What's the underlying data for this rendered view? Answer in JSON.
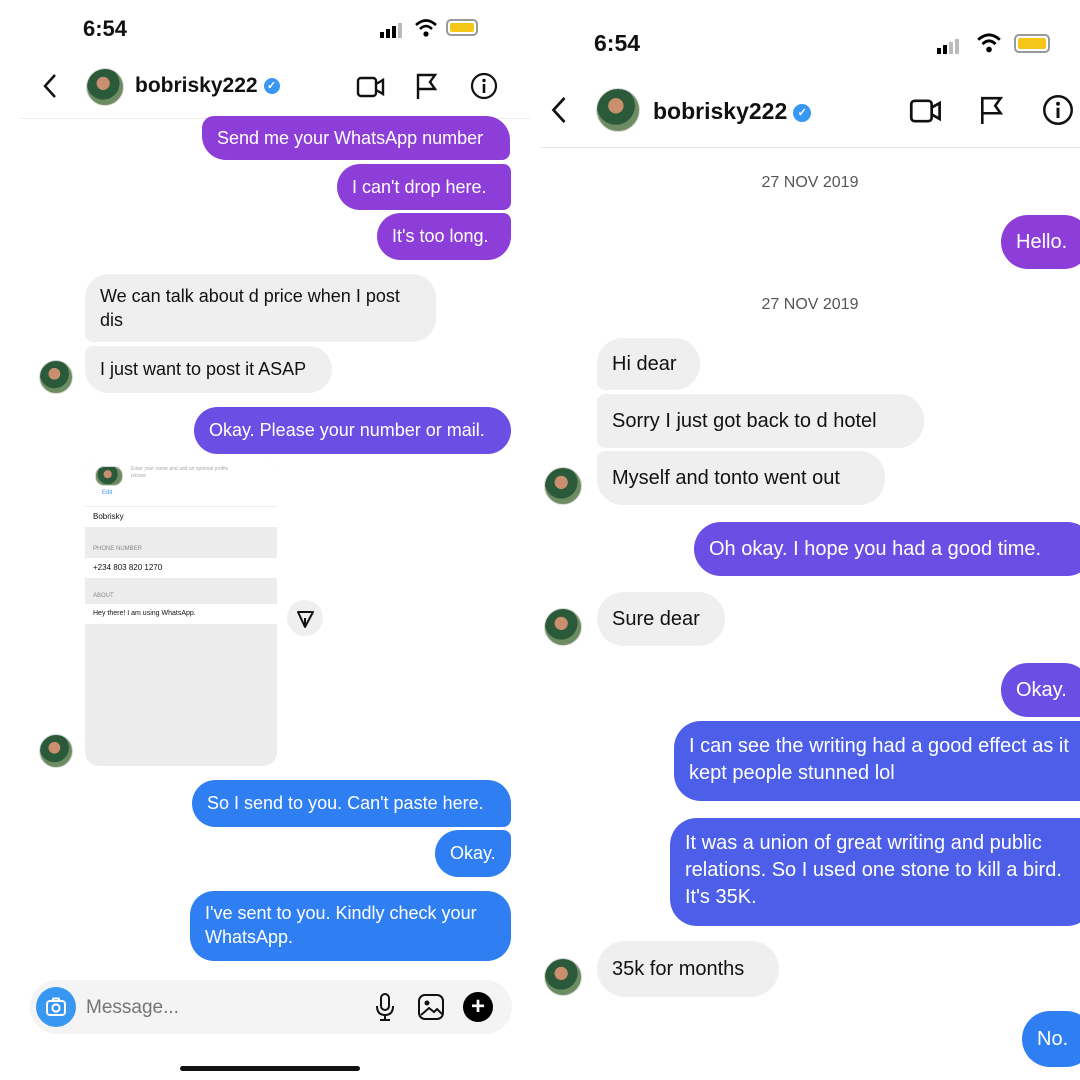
{
  "left": {
    "status": {
      "time": "6:54"
    },
    "header": {
      "username": "bobrisky222",
      "verified_mark": "✓"
    },
    "messages": [
      {
        "text": "Send me your WhatsApp number"
      },
      {
        "text": "I can't drop here."
      },
      {
        "text": "It's too long."
      },
      {
        "text": "We can talk about d price when I post dis"
      },
      {
        "text": "I just want to post it ASAP"
      },
      {
        "text": "Okay. Please your number or mail."
      },
      {
        "text": "So I send to you. Can't paste here."
      },
      {
        "text": "Okay."
      },
      {
        "text": "I've sent to you. Kindly check your WhatsApp."
      }
    ],
    "screenshot": {
      "hint": "Enter your name and add an optional profile picture",
      "edit": "Edit",
      "name": "Bobrisky",
      "phone_label": "PHONE NUMBER",
      "phone": "+234 803 820 1270",
      "about_label": "ABOUT",
      "about": "Hey there! I am using WhatsApp."
    },
    "composer": {
      "placeholder": "Message..."
    }
  },
  "right": {
    "status": {
      "time": "6:54"
    },
    "header": {
      "username": "bobrisky222",
      "verified_mark": "✓"
    },
    "dates": [
      "27 NOV 2019",
      "27 NOV 2019"
    ],
    "messages": [
      {
        "text": "Hello."
      },
      {
        "text": "Hi dear"
      },
      {
        "text": "Sorry I just got back to d hotel"
      },
      {
        "text": "Myself and tonto went out"
      },
      {
        "text": "Oh okay. I hope you had a good time."
      },
      {
        "text": "Sure dear"
      },
      {
        "text": "Okay."
      },
      {
        "text": "I can see the writing had a good effect as it kept people stunned lol"
      },
      {
        "text": "It was a union of great writing and public relations. So I used one stone to kill a bird. It's 35K."
      },
      {
        "text": "35k for months"
      },
      {
        "text": "No."
      }
    ]
  },
  "colors": {
    "purple": "#8e3ed8",
    "violet": "#6b4fe4",
    "blue": "#2f7ff3",
    "incoming": "#efefef",
    "verified": "#3897f0",
    "battery": "#f5c518"
  }
}
